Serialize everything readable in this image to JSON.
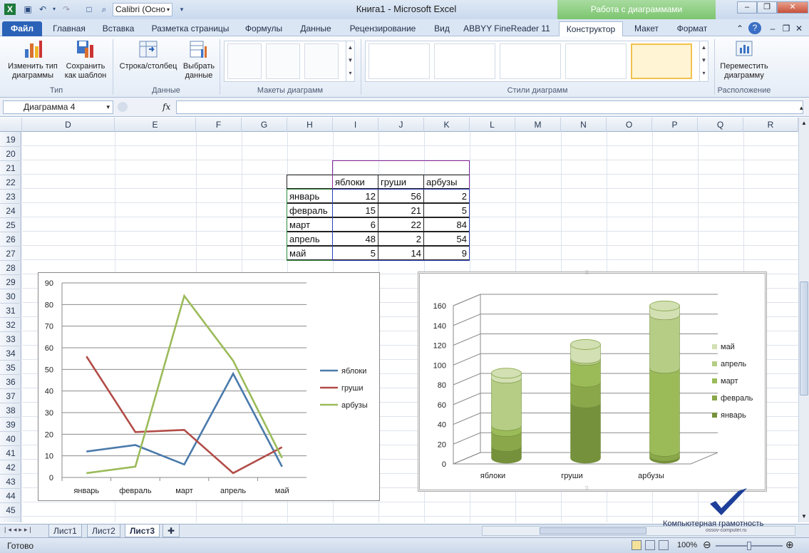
{
  "title_bar": {
    "app_title": "Книга1 - Microsoft Excel",
    "context_title": "Работа с диаграммами",
    "font_box": "Calibri (Осно"
  },
  "tabs": [
    "Файл",
    "Главная",
    "Вставка",
    "Разметка страницы",
    "Формулы",
    "Данные",
    "Рецензирование",
    "Вид",
    "ABBYY FineReader 11",
    "Конструктор",
    "Макет",
    "Формат"
  ],
  "ribbon": {
    "change_type": "Изменить тип диаграммы",
    "save_template": "Сохранить как шаблон",
    "group_type": "Тип",
    "row_col": "Строка/столбец",
    "select_data": "Выбрать данные",
    "group_data": "Данные",
    "group_layouts": "Макеты диаграмм",
    "group_styles": "Стили диаграмм",
    "move_chart": "Переместить диаграмму",
    "group_location": "Расположение"
  },
  "formula_bar": {
    "name_box": "Диаграмма 4",
    "fx": "fx",
    "value": ""
  },
  "columns": [
    "D",
    "E",
    "F",
    "G",
    "H",
    "I",
    "J",
    "K",
    "L",
    "M",
    "N",
    "O",
    "P",
    "Q",
    "R"
  ],
  "rows": [
    "19",
    "20",
    "21",
    "22",
    "23",
    "24",
    "25",
    "26",
    "27",
    "28",
    "29",
    "30",
    "31",
    "32",
    "33",
    "34",
    "35",
    "36",
    "37",
    "38",
    "39",
    "40",
    "41",
    "42",
    "43",
    "44",
    "45"
  ],
  "table": {
    "headers": [
      "яблоки",
      "груши",
      "арбузы"
    ],
    "rows": [
      {
        "month": "январь",
        "values": [
          "12",
          "56",
          "2"
        ]
      },
      {
        "month": "февраль",
        "values": [
          "15",
          "21",
          "5"
        ]
      },
      {
        "month": "март",
        "values": [
          "6",
          "22",
          "84"
        ]
      },
      {
        "month": "апрель",
        "values": [
          "48",
          "2",
          "54"
        ]
      },
      {
        "month": "май",
        "values": [
          "5",
          "14",
          "9"
        ]
      }
    ]
  },
  "chart_data": [
    {
      "type": "line",
      "categories": [
        "январь",
        "февраль",
        "март",
        "апрель",
        "май"
      ],
      "series": [
        {
          "name": "яблоки",
          "values": [
            12,
            15,
            6,
            48,
            5
          ],
          "color": "#4a7aab"
        },
        {
          "name": "груши",
          "values": [
            56,
            21,
            22,
            2,
            14
          ],
          "color": "#b24c47"
        },
        {
          "name": "арбузы",
          "values": [
            2,
            5,
            84,
            54,
            9
          ],
          "color": "#9bbb59"
        }
      ],
      "ylim": [
        0,
        90
      ],
      "yticks": [
        "0",
        "10",
        "20",
        "30",
        "40",
        "50",
        "60",
        "70",
        "80",
        "90"
      ],
      "grid": true,
      "legend_position": "right"
    },
    {
      "type": "bar",
      "subtype": "stacked-cylinder-3d",
      "categories": [
        "яблоки",
        "груши",
        "арбузы"
      ],
      "series": [
        {
          "name": "январь",
          "values": [
            12,
            56,
            2
          ],
          "color": "#76913c"
        },
        {
          "name": "февраль",
          "values": [
            15,
            21,
            5
          ],
          "color": "#8aa84a"
        },
        {
          "name": "март",
          "values": [
            6,
            22,
            84
          ],
          "color": "#9bbb59"
        },
        {
          "name": "апрель",
          "values": [
            48,
            2,
            54
          ],
          "color": "#b5cd84"
        },
        {
          "name": "май",
          "values": [
            5,
            14,
            9
          ],
          "color": "#d2e0b3"
        }
      ],
      "legend_order": [
        "май",
        "апрель",
        "март",
        "февраль",
        "январь"
      ],
      "ylim": [
        0,
        160
      ],
      "yticks": [
        "0",
        "20",
        "40",
        "60",
        "80",
        "100",
        "120",
        "140",
        "160"
      ],
      "grid": true,
      "legend_position": "right"
    }
  ],
  "sheets": [
    "Лист1",
    "Лист2",
    "Лист3"
  ],
  "active_sheet": "Лист3",
  "status": {
    "ready": "Готово",
    "zoom": "100%"
  },
  "watermark": {
    "line1": "Компьютерная грамотность",
    "line2": "ossov-computer.ru"
  }
}
